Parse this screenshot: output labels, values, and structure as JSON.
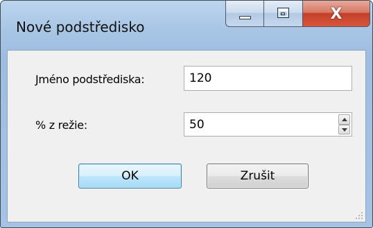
{
  "window": {
    "title": "Nové podstředisko"
  },
  "fields": {
    "name_label": "Jméno podstřediska:",
    "name_value": "120",
    "percent_label": "% z režie:",
    "percent_value": "50"
  },
  "buttons": {
    "ok_label": "OK",
    "cancel_label": "Zrušit"
  },
  "caption_buttons": {
    "close_glyph": "X"
  },
  "icons": [
    "minimize-icon",
    "maximize-icon",
    "close-icon",
    "spin-up-icon",
    "spin-down-icon",
    "resize-grip-icon"
  ],
  "colors": {
    "frame": "#a9c6e5",
    "client": "#f0f0f0",
    "close_button": "#c2412b",
    "default_button_border": "#3c7fb1"
  }
}
